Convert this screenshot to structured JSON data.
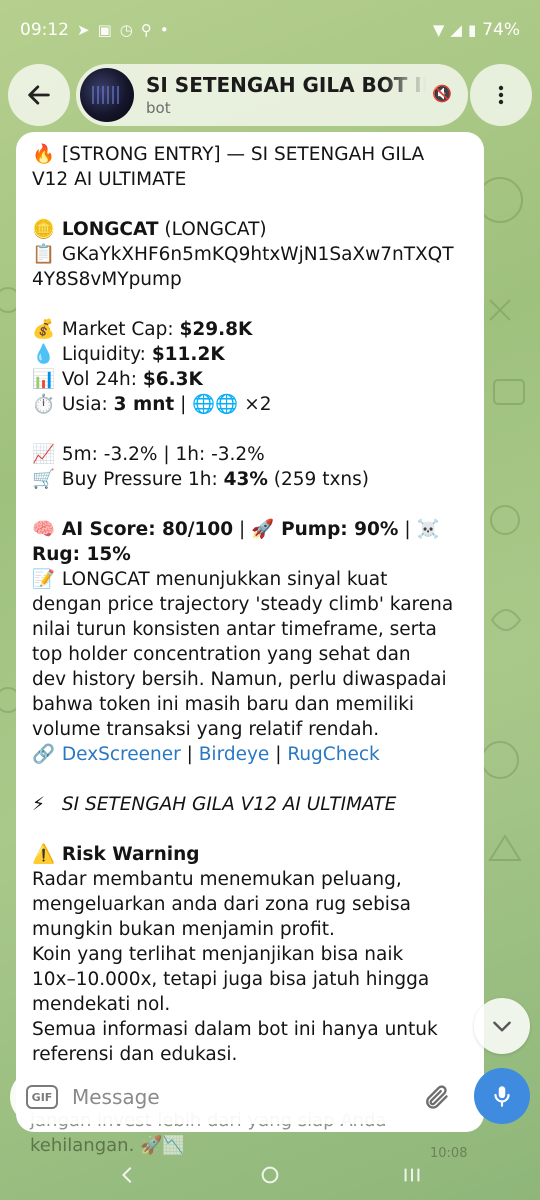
{
  "status_bar": {
    "time": "09:12",
    "battery": "74%"
  },
  "header": {
    "chat_title": "SI SETENGAH GILA BOT INI",
    "chat_subtitle": "bot"
  },
  "message": {
    "line1": "[STRONG ENTRY] — SI SETENGAH GILA",
    "line2": "V12 AI ULTIMATE",
    "token_name": "LONGCAT",
    "token_symbol": " (LONGCAT)",
    "address1": "GKaYkXHF6n5mKQ9htxWjN1SaXw7nTXQT",
    "address2": "4Y8S8vMYpump",
    "mcap_label": "Market Cap: ",
    "mcap_value": "$29.8K",
    "liq_label": "Liquidity: ",
    "liq_value": "$11.2K",
    "vol_label": "Vol 24h: ",
    "vol_value": "$6.3K",
    "age_label": "Usia: ",
    "age_value": "3 mnt",
    "age_rest": " | 🌐🌐 ×2",
    "change_line": "5m: -3.2% | 1h: -3.2%",
    "bp_label": "Buy Pressure 1h: ",
    "bp_value": "43%",
    "bp_rest": " (259 txns)",
    "ai_score": "AI Score: 80/100",
    "pump": "Pump: 90%",
    "rug_line": "Rug: 15%",
    "desc1": "LONGCAT menunjukkan sinyal kuat",
    "desc2": "dengan price trajectory 'steady climb' karena",
    "desc3": "nilai turun konsisten antar timeframe, serta",
    "desc4": "top holder concentration yang sehat dan",
    "desc5": "dev history bersih. Namun, perlu diwaspadai",
    "desc6": "bahwa token ini masih baru dan memiliki",
    "desc7": "volume transaksi yang relatif rendah.",
    "link_dex": "DexScreener",
    "link_bird": "Birdeye",
    "link_rug": "RugCheck",
    "signature": "SI SETENGAH GILA V12 AI ULTIMATE",
    "risk_title": "Risk Warning",
    "risk1": "Radar membantu menemukan peluang,",
    "risk2": "mengeluarkan anda dari zona rug sebisa",
    "risk3": "mungkin bukan menjamin profit.",
    "risk4": "Koin yang terlihat menjanjikan bisa naik",
    "risk5": "10x–10.000x, tetapi juga bisa jatuh hingga",
    "risk6": "mendekati nol.",
    "risk7": "Semua informasi dalam bot ini hanya untuk",
    "risk8": "referensi dan edukasi."
  },
  "below": {
    "line1": "jangan invest lebih dari yang siap Anda",
    "line2": "kehilangan. 🚀📉",
    "time": "10:08"
  },
  "composer": {
    "gif_label": "GIF",
    "placeholder": "Message"
  },
  "icons": {
    "back": "arrow-left",
    "menu": "dots-vertical",
    "attach": "paperclip",
    "mic": "microphone",
    "scroll": "chevron-down"
  }
}
